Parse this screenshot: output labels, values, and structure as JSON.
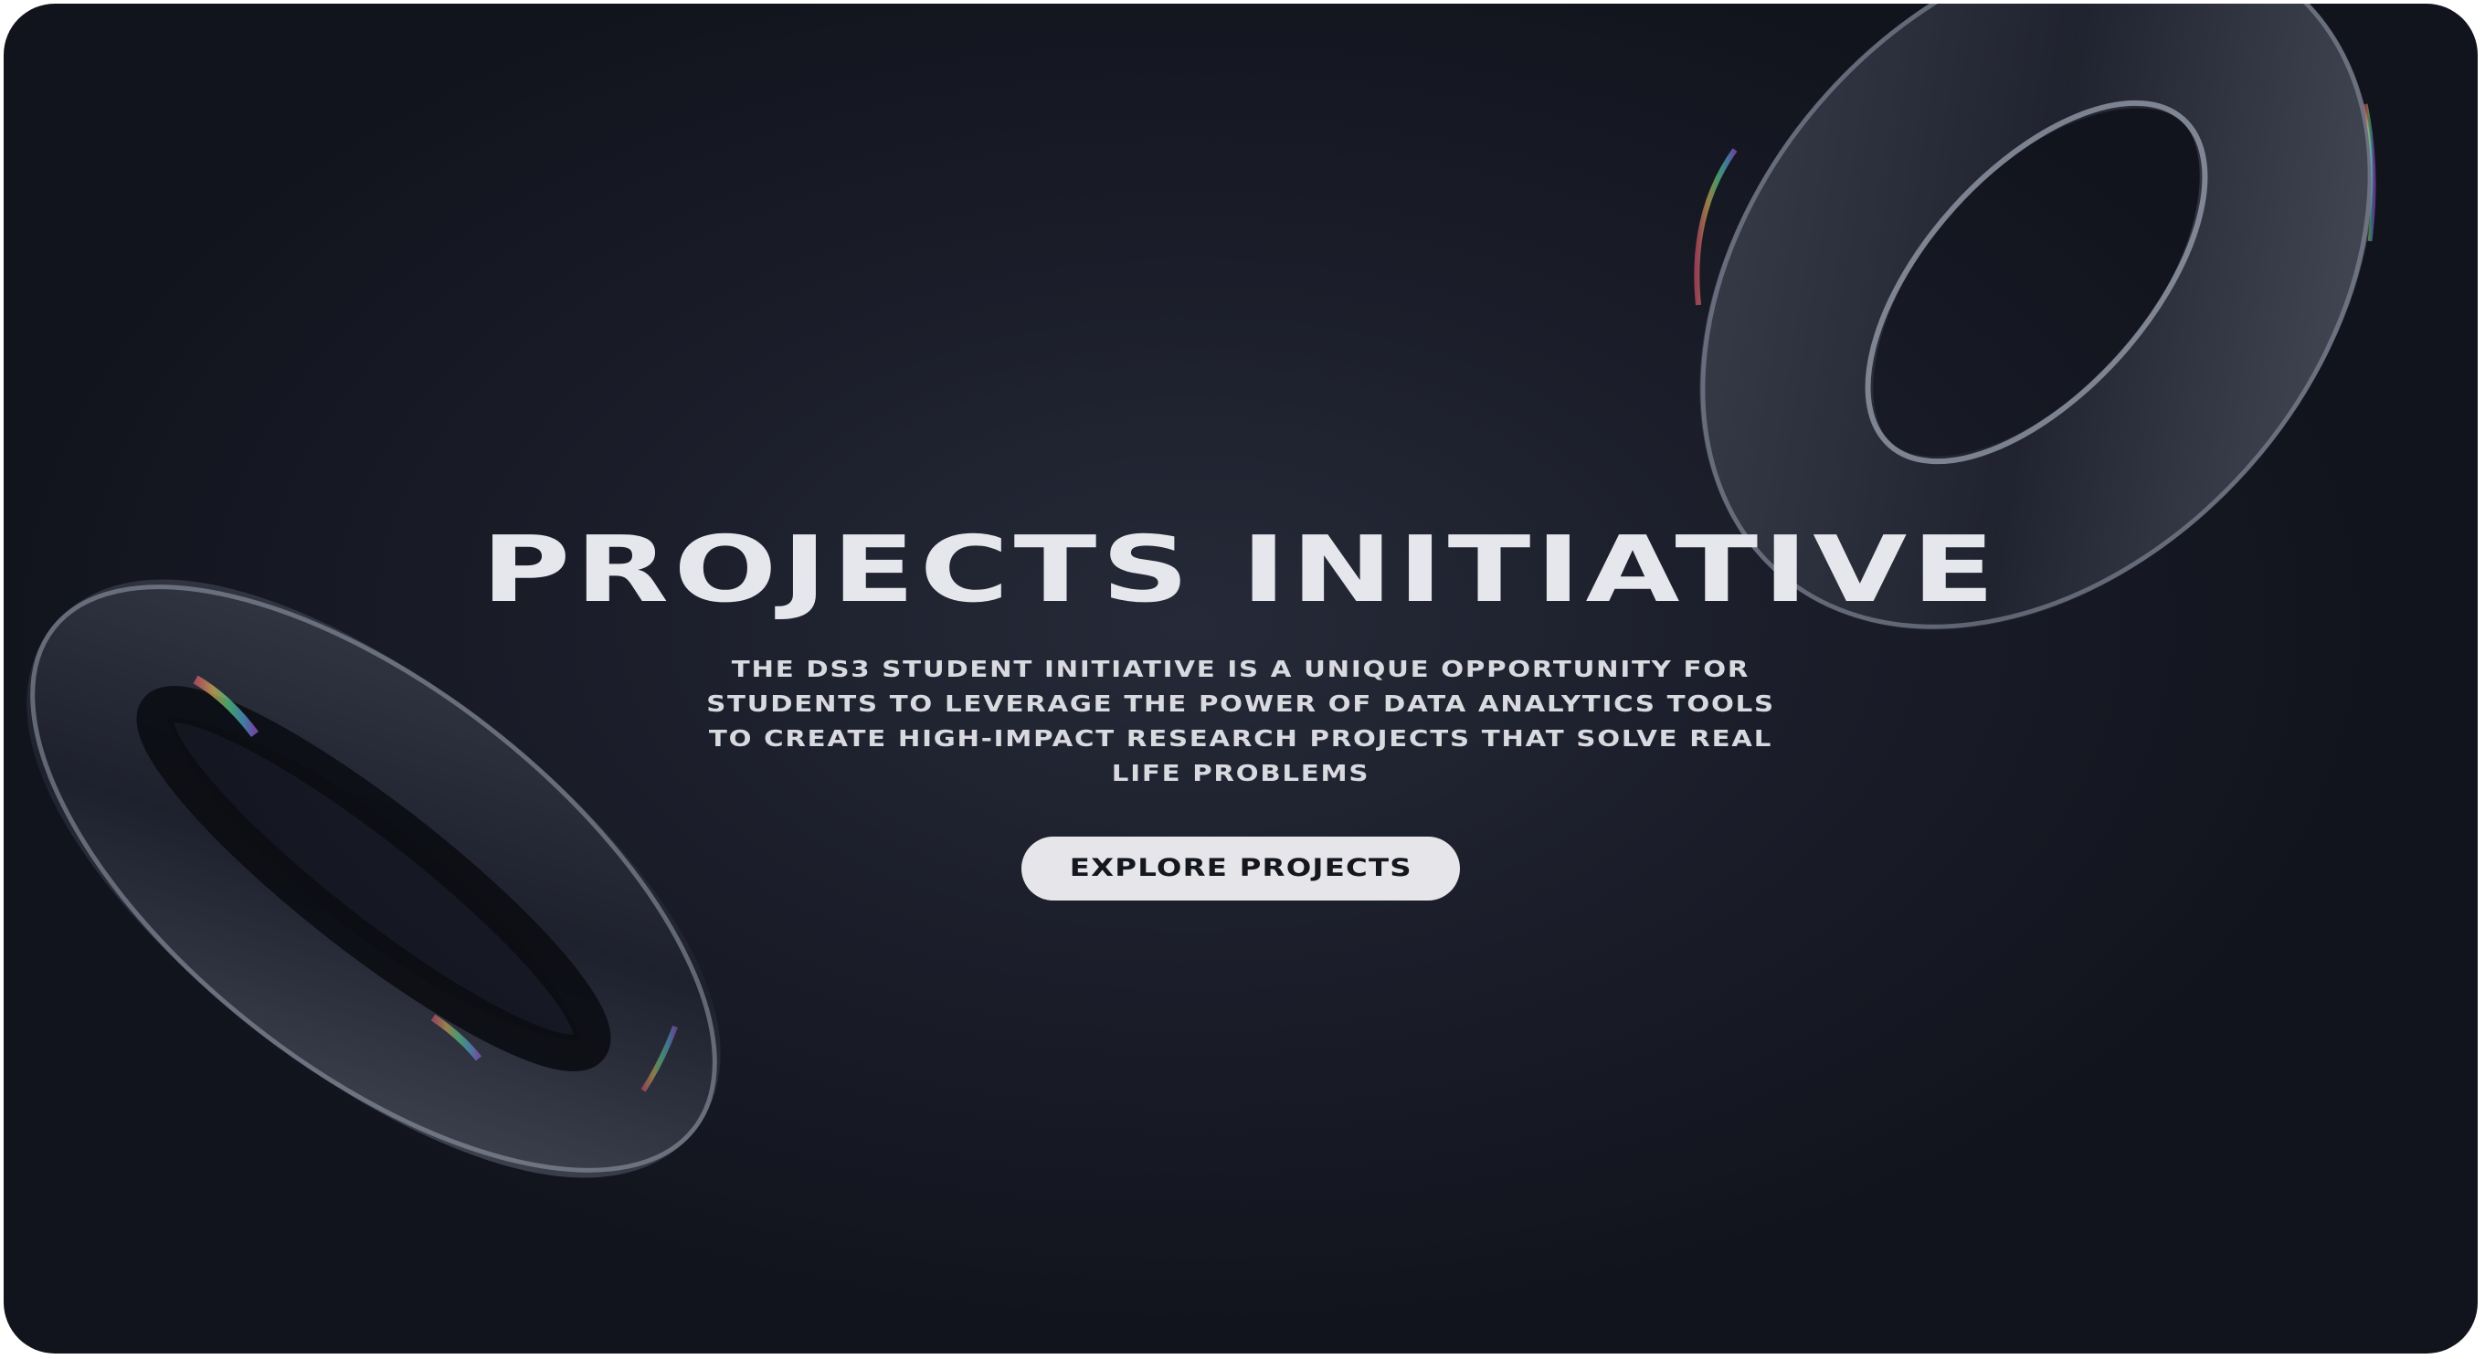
{
  "hero": {
    "title": "PROJECTS INITIATIVE",
    "description": "THE DS3 STUDENT INITIATIVE IS A UNIQUE OPPORTUNITY FOR STUDENTS TO LEVERAGE THE POWER OF DATA ANALYTICS TOOLS TO CREATE HIGH-IMPACT RESEARCH PROJECTS THAT SOLVE REAL LIFE PROBLEMS",
    "cta_label": "EXPLORE PROJECTS"
  },
  "colors": {
    "background": "#1c1f2b",
    "title_text": "#e6e7ec",
    "button_bg": "#e6e6ea",
    "button_text": "#15171f"
  },
  "decorations": [
    "torus-ring-top-right",
    "torus-ring-left"
  ]
}
